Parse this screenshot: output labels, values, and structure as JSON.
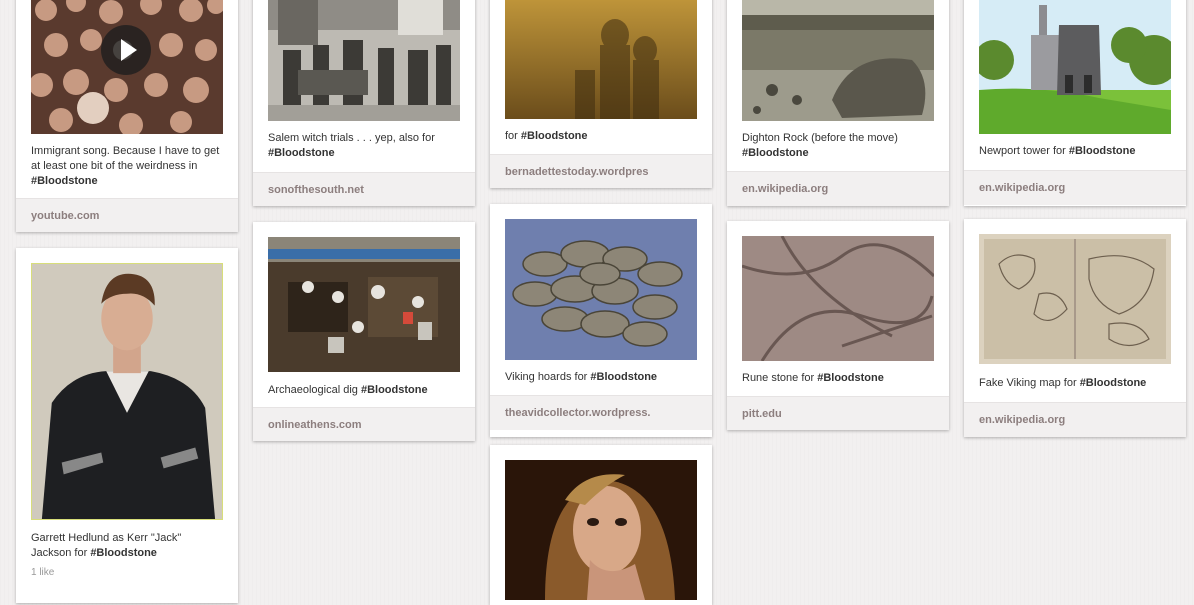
{
  "pins": [
    {
      "id": "immigrant",
      "desc": "Immigrant song. Because I have to get at least one bit of the weirdness in",
      "tag": "#Bloodstone",
      "source": "youtube.com"
    },
    {
      "id": "garrett",
      "desc": "Garrett Hedlund as Kerr \"Jack\" Jackson for",
      "tag": "#Bloodstone",
      "likes": "1 like"
    },
    {
      "id": "salem",
      "desc": "Salem witch trials . . . yep, also for",
      "tag": "#Bloodstone",
      "source": "sonofthesouth.net"
    },
    {
      "id": "dig",
      "desc": "Archaeological dig",
      "tag": "#Bloodstone",
      "source": "onlineathens.com"
    },
    {
      "id": "for",
      "desc": "for",
      "tag": "#Bloodstone",
      "source": "bernadettestoday.wordpres"
    },
    {
      "id": "hoards",
      "desc": "Viking hoards for",
      "tag": "#Bloodstone",
      "source": "theavidcollector.wordpress."
    },
    {
      "id": "dighton",
      "desc": "Dighton Rock (before the move)",
      "tag": "#Bloodstone",
      "source": "en.wikipedia.org"
    },
    {
      "id": "rune",
      "desc": "Rune stone for",
      "tag": "#Bloodstone",
      "source": "pitt.edu"
    },
    {
      "id": "newport",
      "desc": "Newport tower for",
      "tag": "#Bloodstone",
      "source": "en.wikipedia.org"
    },
    {
      "id": "map",
      "desc": "Fake Viking map for",
      "tag": "#Bloodstone",
      "source": "en.wikipedia.org"
    }
  ],
  "colors": {
    "background": "#f2f0f0",
    "card": "#ffffff",
    "source_bar": "#f2f0f0",
    "source_text": "#8c7e7e"
  },
  "icons": {
    "video": "play-icon"
  }
}
